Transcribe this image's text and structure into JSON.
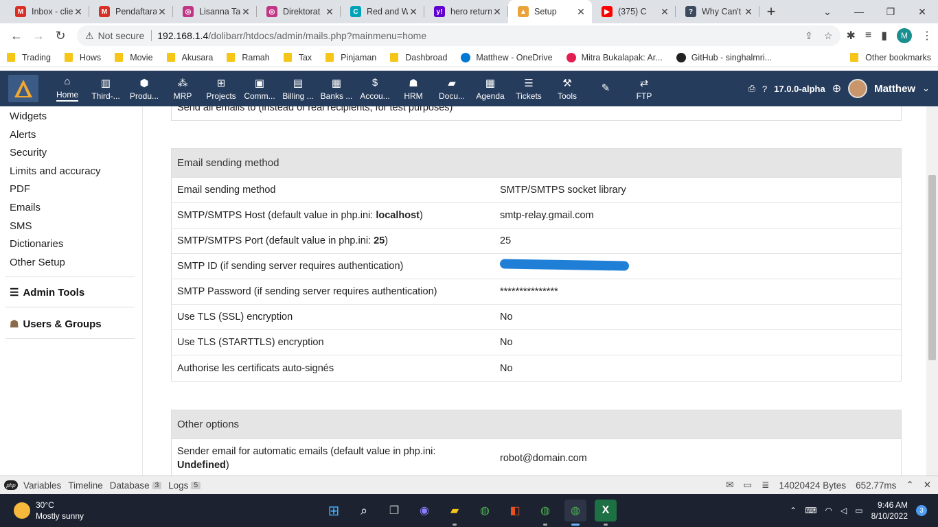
{
  "browser": {
    "tabs": [
      {
        "title": "Inbox - clie",
        "icon": "gmail-icon",
        "color": "#d93025",
        "glyph": "M"
      },
      {
        "title": "Pendaftara",
        "icon": "gmail-icon",
        "color": "#d93025",
        "glyph": "M"
      },
      {
        "title": "Lisanna Ta",
        "icon": "instagram-icon",
        "color": "#c13584",
        "glyph": "◎"
      },
      {
        "title": "Direktorat",
        "icon": "instagram-icon",
        "color": "#c13584",
        "glyph": "◎"
      },
      {
        "title": "Red and W",
        "icon": "canva-icon",
        "color": "#00a2b8",
        "glyph": "C"
      },
      {
        "title": "hero return",
        "icon": "yahoo-icon",
        "color": "#6001d2",
        "glyph": "y!"
      },
      {
        "title": "Setup",
        "icon": "dolibarr-icon",
        "color": "#e8a33d",
        "glyph": "▲",
        "active": true
      },
      {
        "title": "(375) C",
        "icon": "youtube-icon",
        "color": "#ff0000",
        "glyph": "▶"
      },
      {
        "title": "Why Can't",
        "icon": "forum-icon",
        "color": "#3c4a5e",
        "glyph": "?"
      }
    ],
    "new_tab": "+",
    "address": {
      "not_secure": "Not secure",
      "host": "192.168.1.4",
      "path": "/dolibarr/htdocs/admin/mails.php?mainmenu=home"
    },
    "profile_initial": "M",
    "bookmarks": [
      {
        "label": "Trading",
        "type": "folder"
      },
      {
        "label": "Hows",
        "type": "folder"
      },
      {
        "label": "Movie",
        "type": "folder"
      },
      {
        "label": "Akusara",
        "type": "folder"
      },
      {
        "label": "Ramah",
        "type": "folder"
      },
      {
        "label": "Tax",
        "type": "folder"
      },
      {
        "label": "Pinjaman",
        "type": "folder"
      },
      {
        "label": "Dashbroad",
        "type": "folder"
      },
      {
        "label": "Matthew - OneDrive",
        "type": "onedrive",
        "color": "#0078d4"
      },
      {
        "label": "Mitra Bukalapak: Ar...",
        "type": "site",
        "color": "#e31e52"
      },
      {
        "label": "GitHub - singhalmri...",
        "type": "github",
        "color": "#222222"
      }
    ],
    "other_bookmarks": "Other bookmarks"
  },
  "dolibarr": {
    "menu": [
      {
        "label": "Home",
        "icon": "home-icon",
        "glyph": "⌂",
        "active": true
      },
      {
        "label": "Third-...",
        "icon": "building-icon",
        "glyph": "▥"
      },
      {
        "label": "Produ...",
        "icon": "cube-icon",
        "glyph": "⬢"
      },
      {
        "label": "MRP",
        "icon": "cubes-icon",
        "glyph": "⁂"
      },
      {
        "label": "Projects",
        "icon": "sitemap-icon",
        "glyph": "⊞"
      },
      {
        "label": "Comm...",
        "icon": "suitcase-icon",
        "glyph": "▣"
      },
      {
        "label": "Billing ...",
        "icon": "invoice-icon",
        "glyph": "▤"
      },
      {
        "label": "Banks ...",
        "icon": "bank-icon",
        "glyph": "▦"
      },
      {
        "label": "Accou...",
        "icon": "dollar-search-icon",
        "glyph": "$"
      },
      {
        "label": "HRM",
        "icon": "user-tie-icon",
        "glyph": "☗"
      },
      {
        "label": "Docu...",
        "icon": "folder-icon",
        "glyph": "▰"
      },
      {
        "label": "Agenda",
        "icon": "calendar-icon",
        "glyph": "▦"
      },
      {
        "label": "Tickets",
        "icon": "ticket-icon",
        "glyph": "☰"
      },
      {
        "label": "Tools",
        "icon": "wrench-icon",
        "glyph": "⚒"
      },
      {
        "label": "",
        "icon": "edit-icon",
        "glyph": "✎"
      },
      {
        "label": "FTP",
        "icon": "exchange-icon",
        "glyph": "⇄"
      }
    ],
    "version": "17.0.0-alpha",
    "user": "Matthew"
  },
  "left_menu": {
    "items": [
      "Widgets",
      "Alerts",
      "Security",
      "Limits and accuracy",
      "PDF",
      "Emails",
      "SMS",
      "Dictionaries",
      "Other Setup"
    ],
    "admin_tools": "Admin Tools",
    "users_groups": "Users & Groups"
  },
  "main": {
    "cut_row": "Send all emails to (instead of real recipients, for test purposes)",
    "email_section": {
      "title": "Email sending method",
      "rows": [
        {
          "label": "Email sending method",
          "value": "SMTP/SMTPS socket library"
        },
        {
          "label_pre": "SMTP/SMTPS Host (default value in php.ini: ",
          "label_bold": "localhost",
          "label_post": ")",
          "value": "smtp-relay.gmail.com"
        },
        {
          "label_pre": "SMTP/SMTPS Port (default value in php.ini: ",
          "label_bold": "25",
          "label_post": ")",
          "value": "25"
        },
        {
          "label": "SMTP ID (if sending server requires authentication)",
          "value": ""
        },
        {
          "label": "SMTP Password (if sending server requires authentication)",
          "value": "***************"
        },
        {
          "label": "Use TLS (SSL) encryption",
          "value": "No"
        },
        {
          "label": "Use TLS (STARTTLS) encryption",
          "value": "No"
        },
        {
          "label": "Authorise les certificats auto-signés",
          "value": "No"
        }
      ]
    },
    "other_section": {
      "title": "Other options",
      "row": {
        "label_pre": "Sender email for automatic emails (default value in php.ini:",
        "label_bold": "Undefined",
        "label_post": ")",
        "value": "robot@domain.com"
      }
    }
  },
  "debugbar": {
    "tabs": [
      {
        "label": "Variables"
      },
      {
        "label": "Timeline"
      },
      {
        "label": "Database",
        "badge": "3"
      },
      {
        "label": "Logs",
        "badge": "5"
      }
    ],
    "memory": "14020424 Bytes",
    "time": "652.77ms"
  },
  "taskbar": {
    "temp": "30°C",
    "weather": "Mostly sunny",
    "time": "9:46 AM",
    "date": "8/10/2022",
    "notifications": "3"
  }
}
